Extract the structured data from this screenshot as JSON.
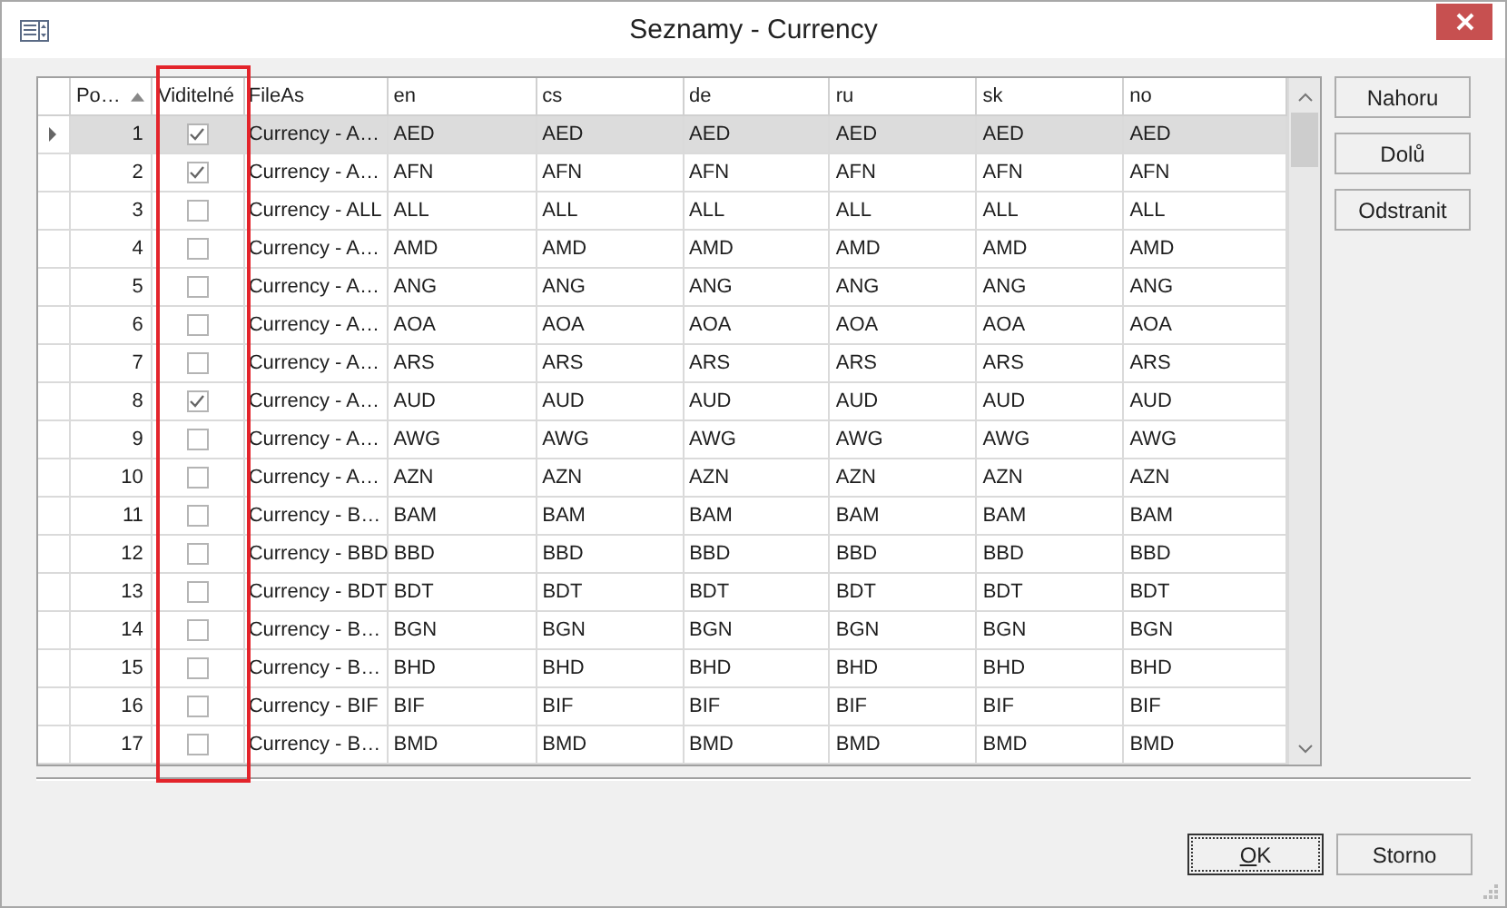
{
  "window": {
    "title": "Seznamy - Currency"
  },
  "table": {
    "columns": [
      {
        "label": "Po…",
        "sorted": true
      },
      {
        "label": "Viditelné",
        "sorted": false
      },
      {
        "label": "FileAs",
        "sorted": false
      },
      {
        "label": "en",
        "sorted": false
      },
      {
        "label": "cs",
        "sorted": false
      },
      {
        "label": "de",
        "sorted": false
      },
      {
        "label": "ru",
        "sorted": false
      },
      {
        "label": "sk",
        "sorted": false
      },
      {
        "label": "no",
        "sorted": false
      }
    ],
    "rows": [
      {
        "selected": true,
        "cells": [
          "1",
          true,
          "Currency - A…",
          "AED",
          "AED",
          "AED",
          "AED",
          "AED",
          "AED"
        ]
      },
      {
        "selected": false,
        "cells": [
          "2",
          true,
          "Currency - A…",
          "AFN",
          "AFN",
          "AFN",
          "AFN",
          "AFN",
          "AFN"
        ]
      },
      {
        "selected": false,
        "cells": [
          "3",
          false,
          "Currency - ALL",
          "ALL",
          "ALL",
          "ALL",
          "ALL",
          "ALL",
          "ALL"
        ]
      },
      {
        "selected": false,
        "cells": [
          "4",
          false,
          "Currency - A…",
          "AMD",
          "AMD",
          "AMD",
          "AMD",
          "AMD",
          "AMD"
        ]
      },
      {
        "selected": false,
        "cells": [
          "5",
          false,
          "Currency - A…",
          "ANG",
          "ANG",
          "ANG",
          "ANG",
          "ANG",
          "ANG"
        ]
      },
      {
        "selected": false,
        "cells": [
          "6",
          false,
          "Currency - A…",
          "AOA",
          "AOA",
          "AOA",
          "AOA",
          "AOA",
          "AOA"
        ]
      },
      {
        "selected": false,
        "cells": [
          "7",
          false,
          "Currency - A…",
          "ARS",
          "ARS",
          "ARS",
          "ARS",
          "ARS",
          "ARS"
        ]
      },
      {
        "selected": false,
        "cells": [
          "8",
          true,
          "Currency - A…",
          "AUD",
          "AUD",
          "AUD",
          "AUD",
          "AUD",
          "AUD"
        ]
      },
      {
        "selected": false,
        "cells": [
          "9",
          false,
          "Currency - A…",
          "AWG",
          "AWG",
          "AWG",
          "AWG",
          "AWG",
          "AWG"
        ]
      },
      {
        "selected": false,
        "cells": [
          "10",
          false,
          "Currency - A…",
          "AZN",
          "AZN",
          "AZN",
          "AZN",
          "AZN",
          "AZN"
        ]
      },
      {
        "selected": false,
        "cells": [
          "11",
          false,
          "Currency - B…",
          "BAM",
          "BAM",
          "BAM",
          "BAM",
          "BAM",
          "BAM"
        ]
      },
      {
        "selected": false,
        "cells": [
          "12",
          false,
          "Currency - BBD",
          "BBD",
          "BBD",
          "BBD",
          "BBD",
          "BBD",
          "BBD"
        ]
      },
      {
        "selected": false,
        "cells": [
          "13",
          false,
          "Currency - BDT",
          "BDT",
          "BDT",
          "BDT",
          "BDT",
          "BDT",
          "BDT"
        ]
      },
      {
        "selected": false,
        "cells": [
          "14",
          false,
          "Currency - B…",
          "BGN",
          "BGN",
          "BGN",
          "BGN",
          "BGN",
          "BGN"
        ]
      },
      {
        "selected": false,
        "cells": [
          "15",
          false,
          "Currency - B…",
          "BHD",
          "BHD",
          "BHD",
          "BHD",
          "BHD",
          "BHD"
        ]
      },
      {
        "selected": false,
        "cells": [
          "16",
          false,
          "Currency - BIF",
          "BIF",
          "BIF",
          "BIF",
          "BIF",
          "BIF",
          "BIF"
        ]
      },
      {
        "selected": false,
        "cells": [
          "17",
          false,
          "Currency - B…",
          "BMD",
          "BMD",
          "BMD",
          "BMD",
          "BMD",
          "BMD"
        ]
      }
    ]
  },
  "side_buttons": [
    "Nahoru",
    "Dolů",
    "Odstranit"
  ],
  "buttons": [
    {
      "label": "OK",
      "default": true
    },
    {
      "label": "Storno",
      "default": false
    }
  ]
}
